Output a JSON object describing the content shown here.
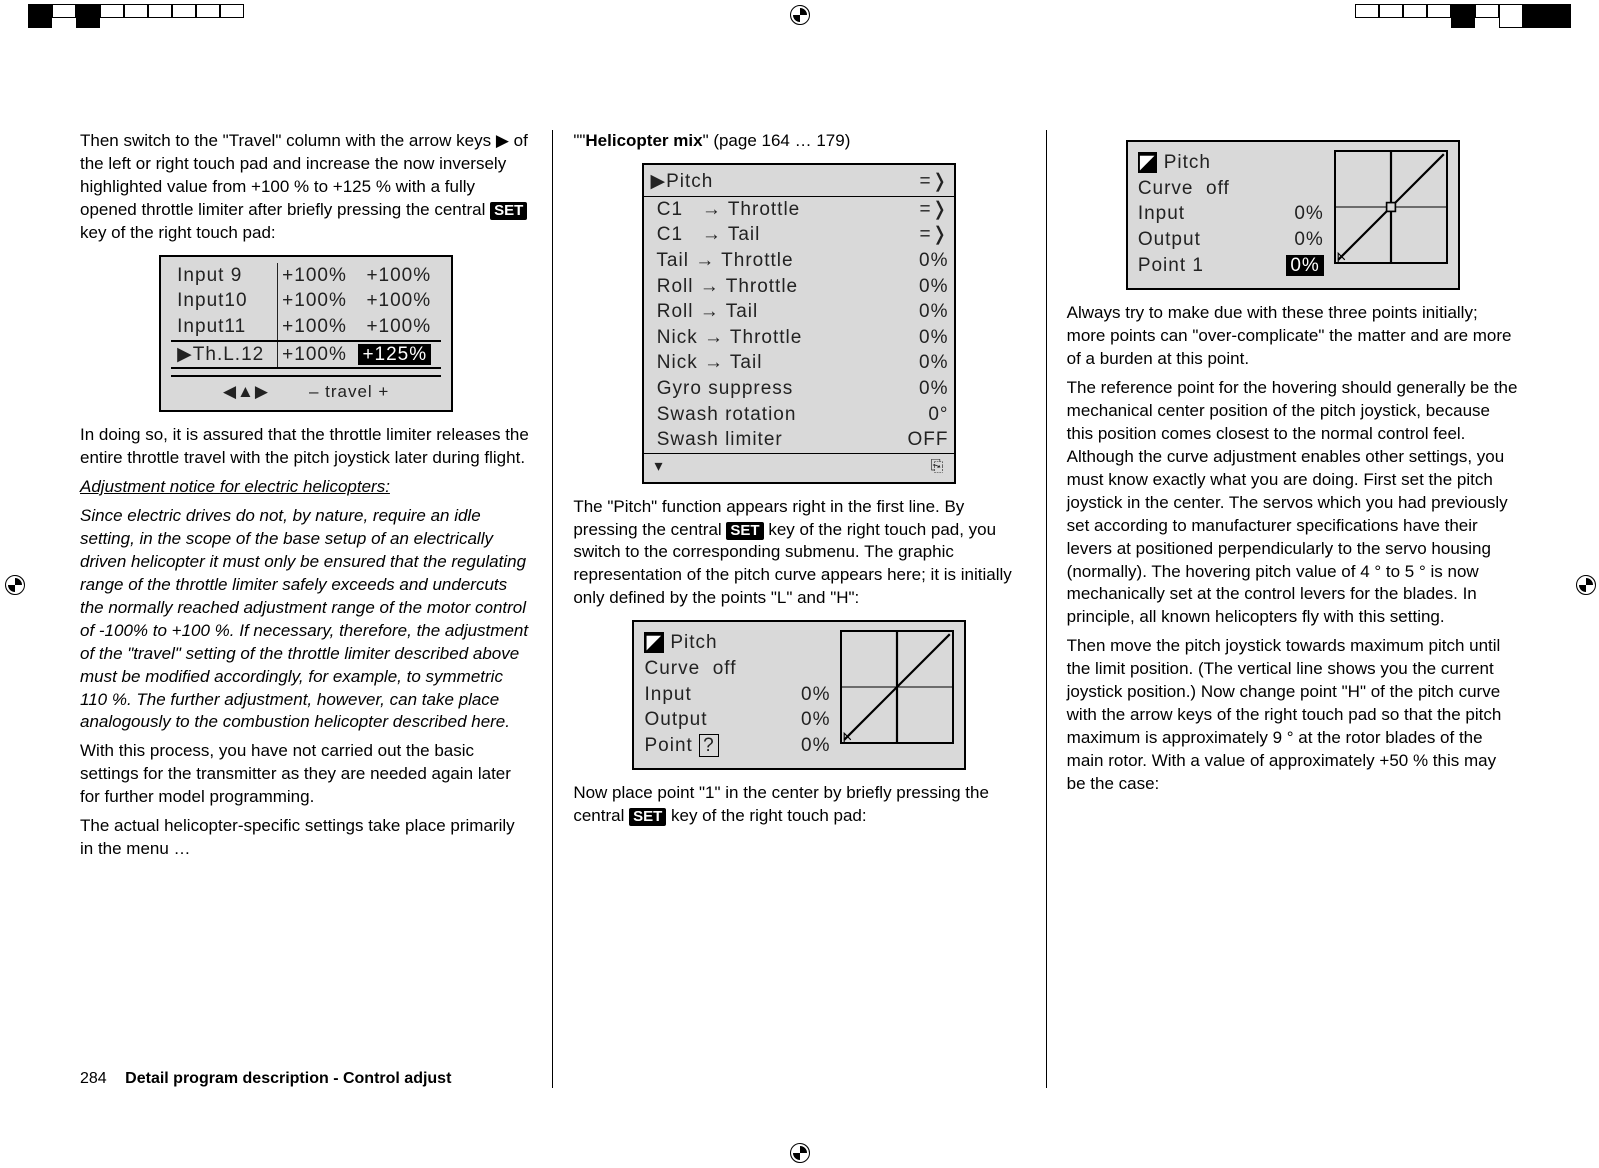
{
  "registration": {
    "mark": "⊕"
  },
  "col1": {
    "p1a": "Then switch to the \"Travel\" column with the arrow keys ",
    "p1b": " of the left or right touch pad and increase the now inversely highlighted value from +100 % to +125 % with a fully opened throttle limiter after briefly pressing the central ",
    "p1c": " key of the right touch pad:",
    "set": "SET",
    "travel_table": {
      "rows": [
        {
          "name": "Input 9",
          "mid": "+100%",
          "right": "+100%",
          "selected": false,
          "inv": false
        },
        {
          "name": "Input10",
          "mid": "+100%",
          "right": "+100%",
          "selected": false,
          "inv": false
        },
        {
          "name": "Input11",
          "mid": "+100%",
          "right": "+100%",
          "selected": false,
          "inv": false
        },
        {
          "name": "▶Th.L.12",
          "mid": "+100%",
          "right": "+125%",
          "selected": true,
          "inv": true
        }
      ],
      "footer_left": "◀▲▶",
      "footer_right": "– travel +"
    },
    "p2": "In doing so, it is assured that the throttle limiter releases the entire throttle travel with the pitch joystick later during flight.",
    "adj_head": "Adjustment notice for electric helicopters:",
    "adj_body": "Since electric drives do not, by nature, require an idle setting, in the scope of the base setup of an electrically driven helicopter it must only be ensured that the regulating range of the throttle limiter safely exceeds and undercuts the normally reached adjustment range of the motor control of -100% to +100 %. If necessary, therefore, the adjustment of the \"travel\" setting of the throttle limiter described above must be modified accordingly, for example, to symmetric 110 %. The further adjustment, however, can take place analogously to the combustion helicopter described here.",
    "p3": "With this process, you have not carried out the basic settings for the transmitter as they are needed again later for further model programming.",
    "p4": "The actual helicopter-specific settings take place primarily in the menu …"
  },
  "col2": {
    "head_a": "\"\"",
    "head_b": "Helicopter mix",
    "head_c": "\" (page 164 … 179)",
    "mix": [
      {
        "label": "▶Pitch",
        "value": "=❭"
      },
      {
        "label": " C1   → Throttle",
        "value": "=❭"
      },
      {
        "label": " C1   → Tail",
        "value": "=❭"
      },
      {
        "label": " Tail → Throttle",
        "value": "0%"
      },
      {
        "label": " Roll → Throttle",
        "value": "0%"
      },
      {
        "label": " Roll → Tail",
        "value": "0%"
      },
      {
        "label": " Nick → Throttle",
        "value": "0%"
      },
      {
        "label": " Nick → Tail",
        "value": "0%"
      },
      {
        "label": " Gyro suppress",
        "value": "0%"
      },
      {
        "label": " Swash rotation",
        "value": "0°"
      },
      {
        "label": " Swash limiter",
        "value": "OFF"
      }
    ],
    "mix_footer_left": "▾",
    "mix_footer_right": "⎘",
    "p1a": "The \"Pitch\" function appears right in the first line. By pressing the central ",
    "p1b": " key of the right touch pad, you switch to the corresponding submenu. The graphic representation of the pitch curve appears here; it is initially only defined by the points \"L\" and \"H\":",
    "curve1": {
      "title_icon": "◤",
      "title": " Pitch",
      "rows": [
        {
          "l": "Curve  off",
          "v": ""
        },
        {
          "l": "Input",
          "v": "0%"
        },
        {
          "l": "Output",
          "v": "0%"
        },
        {
          "l": "Point ?",
          "v": "0%",
          "boxed": true
        }
      ]
    },
    "p2a": "Now place point \"1\" in the center by briefly pressing the central ",
    "p2b": " key of the right touch pad:"
  },
  "col3": {
    "curve2": {
      "title_icon": "◤",
      "title": " Pitch",
      "rows": [
        {
          "l": "Curve  off",
          "v": ""
        },
        {
          "l": "Input",
          "v": "0%"
        },
        {
          "l": "Output",
          "v": "0%"
        },
        {
          "l": "Point 1",
          "v": "0%",
          "inv": true
        }
      ]
    },
    "p1": "Always try to make due with these three points initially; more points can \"over-complicate\" the matter and are more of a burden at this point.",
    "p2": "The reference point for the hovering should generally be the mechanical center position of the pitch joystick, because this position comes closest to the normal control feel. Although the curve adjustment enables other settings, you must know exactly what you are doing. First set the pitch joystick in the center. The servos which you had previously set according to manufacturer specifications have their levers at positioned perpendicularly to the servo housing (normally). The hovering pitch value of 4 ° to 5 ° is now mechanically set at the control levers for the blades. In principle, all known helicopters fly with this setting.",
    "p3": "Then move the pitch joystick towards maximum pitch until the limit position. (The vertical line shows you the current joystick position.) Now change point \"H\" of the pitch curve with the arrow keys of the right touch pad so that the pitch maximum is approximately 9 ° at the rotor blades of the main rotor. With a value of approximately +50 % this may be the case:"
  },
  "footer": {
    "page_no": "284",
    "title": "Detail program description - Control adjust"
  },
  "icons": {
    "right_tri": "▶"
  }
}
